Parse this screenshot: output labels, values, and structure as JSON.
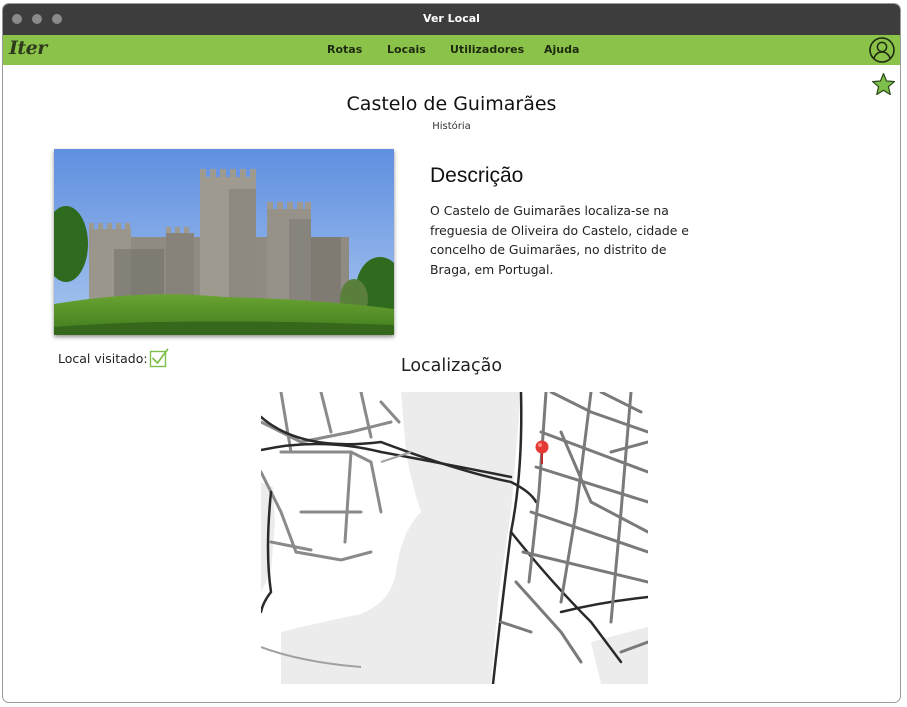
{
  "window": {
    "title": "Ver Local"
  },
  "navbar": {
    "logo": "Iter",
    "items": [
      {
        "label": "Rotas"
      },
      {
        "label": "Locais"
      },
      {
        "label": "Utilizadores"
      },
      {
        "label": "Ajuda"
      }
    ],
    "user_icon": "user-icon",
    "favorite_icon": "star-icon"
  },
  "place": {
    "name": "Castelo de Guimarães",
    "category": "História",
    "description_heading": "Descrição",
    "description": "O Castelo de Guimarães localiza-se na freguesia de Oliveira do Castelo, cidade e concelho de Guimarães, no distrito de Braga, em Portugal.",
    "visited_label": "Local visitado:",
    "visited": true,
    "location_heading": "Localização"
  },
  "colors": {
    "navbar": "#8bc34a",
    "titlebar": "#3d3d3d",
    "accent_green": "#7cc04b",
    "pin": "#e53935"
  }
}
